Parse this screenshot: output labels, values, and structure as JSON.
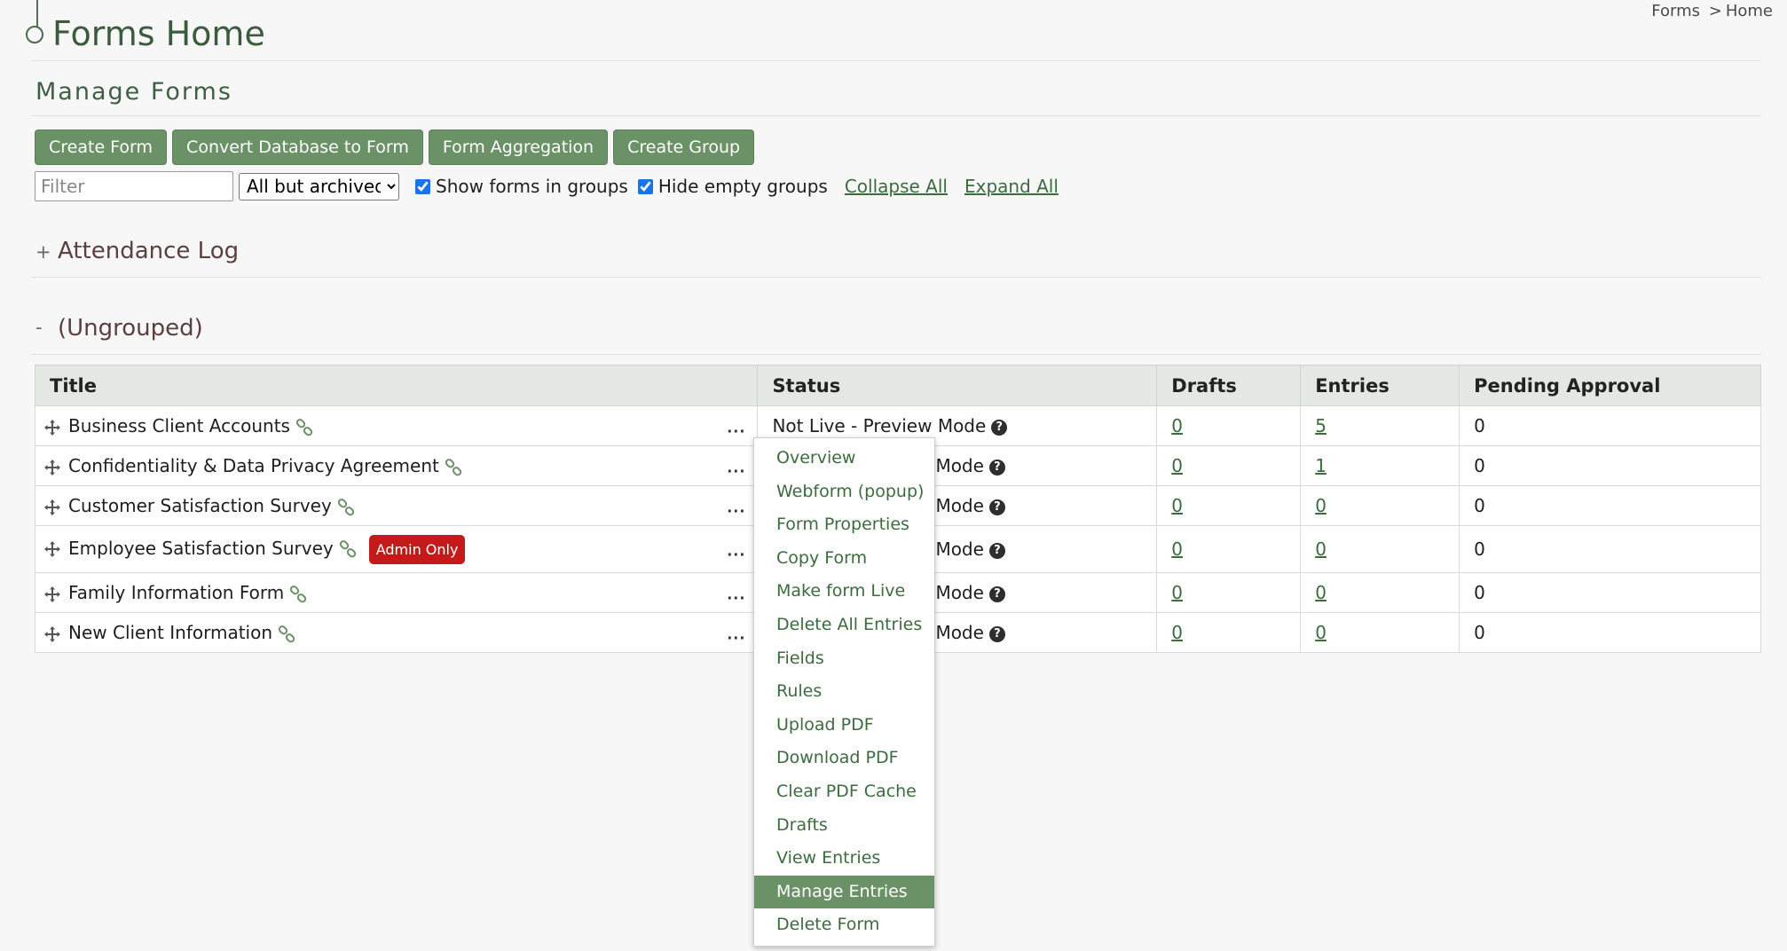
{
  "breadcrumb": {
    "forms": "Forms",
    "separator": ">",
    "home": "Home"
  },
  "page_title": "Forms Home",
  "section_title": "Manage Forms",
  "toolbar": {
    "create_form": "Create Form",
    "convert_db": "Convert Database to Form",
    "aggregation": "Form Aggregation",
    "create_group": "Create Group"
  },
  "filters": {
    "filter_placeholder": "Filter",
    "filter_value": "",
    "archive_select": "All but archived",
    "show_in_groups": "Show forms in groups",
    "show_in_groups_checked": true,
    "hide_empty": "Hide empty groups",
    "hide_empty_checked": true,
    "collapse_all": "Collapse All",
    "expand_all": "Expand All"
  },
  "groups": [
    {
      "toggle": "+",
      "name": "Attendance Log"
    },
    {
      "toggle": "-",
      "name": "(Ungrouped)"
    }
  ],
  "table": {
    "headers": [
      "Title",
      "Status",
      "Drafts",
      "Entries",
      "Pending Approval"
    ],
    "rows": [
      {
        "title": "Business Client Accounts",
        "status": "Not Live - Preview Mode",
        "drafts": "0",
        "entries": "5",
        "pending": "0"
      },
      {
        "title": "Confidentiality & Data Privacy Agreement",
        "status": "Mode",
        "drafts": "0",
        "entries": "1",
        "pending": "0"
      },
      {
        "title": "Customer Satisfaction Survey",
        "status": "Mode",
        "drafts": "0",
        "entries": "0",
        "pending": "0"
      },
      {
        "title": "Employee Satisfaction Survey",
        "badge": "Admin Only",
        "status": "Mode",
        "drafts": "0",
        "entries": "0",
        "pending": "0"
      },
      {
        "title": "Family Information Form",
        "status": "Mode",
        "drafts": "0",
        "entries": "0",
        "pending": "0"
      },
      {
        "title": "New Client Information",
        "status": "Mode",
        "drafts": "0",
        "entries": "0",
        "pending": "0"
      }
    ],
    "row_menu": "..."
  },
  "help_glyph": "?",
  "context_menu": {
    "items": [
      "Overview",
      "Webform (popup)",
      "Form Properties",
      "Copy Form",
      "Make form Live",
      "Delete All Entries",
      "Fields",
      "Rules",
      "Upload PDF",
      "Download PDF",
      "Clear PDF Cache",
      "Drafts",
      "View Entries",
      "Manage Entries",
      "Delete Form"
    ],
    "active": "Manage Entries"
  },
  "colors": {
    "accent": "#6b9166",
    "badge": "#c41a1a",
    "link": "#3c6b3e",
    "title": "#3c5a3e"
  }
}
